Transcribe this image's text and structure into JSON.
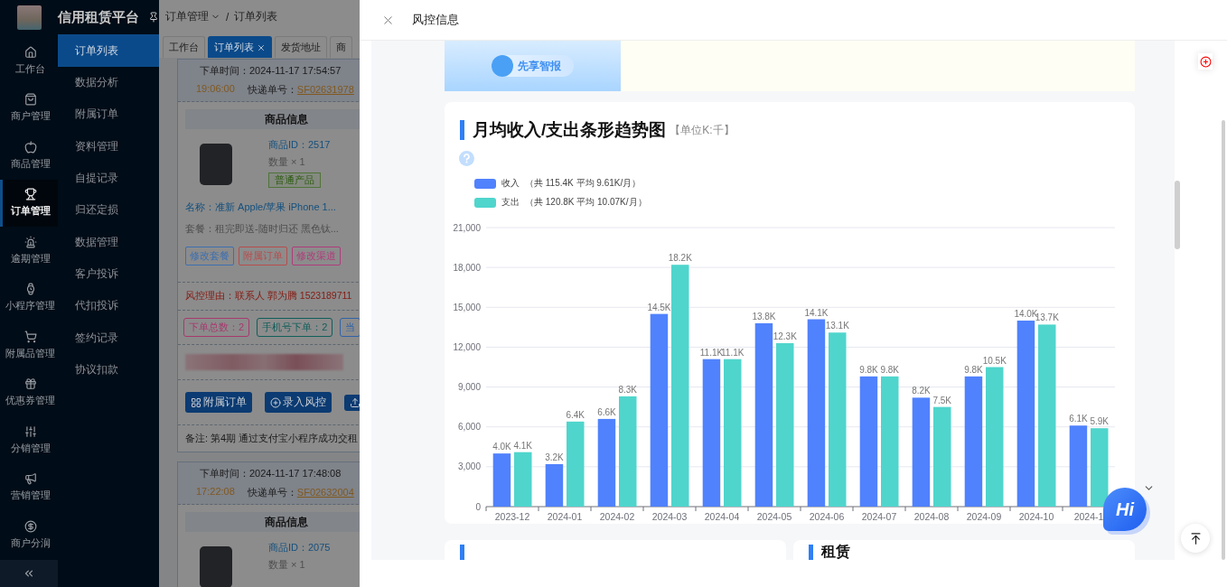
{
  "sidebar": {
    "title": "信用租赁平台",
    "rail": [
      {
        "label": "工作台",
        "selected": false
      },
      {
        "label": "商户管理",
        "selected": false
      },
      {
        "label": "商品管理",
        "selected": false
      },
      {
        "label": "订单管理",
        "selected": true
      },
      {
        "label": "逾期管理",
        "selected": false
      },
      {
        "label": "小程序管理",
        "selected": false
      },
      {
        "label": "附属品管理",
        "selected": false
      },
      {
        "label": "优惠券管理",
        "selected": false
      },
      {
        "label": "分销管理",
        "selected": false
      },
      {
        "label": "营销管理",
        "selected": false
      },
      {
        "label": "商户分润",
        "selected": false
      }
    ],
    "submenu": [
      {
        "label": "订单列表",
        "selected": true
      },
      {
        "label": "数据分析",
        "selected": false
      },
      {
        "label": "附属订单",
        "selected": false
      },
      {
        "label": "资料管理",
        "selected": false
      },
      {
        "label": "自提记录",
        "selected": false
      },
      {
        "label": "归还定损",
        "selected": false
      },
      {
        "label": "数据管理",
        "selected": false
      },
      {
        "label": "客户投诉",
        "selected": false
      },
      {
        "label": "代扣投诉",
        "selected": false
      },
      {
        "label": "签约记录",
        "selected": false
      },
      {
        "label": "协议扣款",
        "selected": false
      }
    ]
  },
  "breadcrumb": {
    "items": [
      "订单管理",
      "订单列表"
    ],
    "separator": "/"
  },
  "tabs": [
    {
      "label": "工作台",
      "selected": false,
      "closable": false
    },
    {
      "label": "订单列表",
      "selected": true,
      "closable": true
    },
    {
      "label": "发货地址",
      "selected": false,
      "closable": false
    },
    {
      "label": "商",
      "selected": false,
      "closable": false
    }
  ],
  "orders": [
    {
      "order_time": "下单时间：2024-11-17 17:54:57",
      "due_time": "19:06:00",
      "tracking_label": "快递单号：",
      "tracking_no": "SF02631978",
      "section_title": "商品信息",
      "product_id": "商品ID：2517",
      "quantity": "数量 × 1",
      "product_tag": "普通产品",
      "name": "名称：准新 Apple/苹果 iPhone 1...",
      "package": "套餐：租完即送-随时归还 黑色钛...",
      "actions": [
        {
          "label": "修改套餐",
          "color": "#3d6fb0"
        },
        {
          "label": "附属订单",
          "color": "#b84c4c"
        },
        {
          "label": "修改渠道",
          "color": "#b03c7a"
        }
      ],
      "risk_reason": "风控理由：联系人 郭为腾 1523189711",
      "stats": [
        {
          "label": "下单总数：2",
          "color": "#a8386e"
        },
        {
          "label": "手机号下单：2",
          "color": "#0f5e5a"
        },
        {
          "label": "当",
          "color": "#2f62a8"
        }
      ],
      "buttons": [
        {
          "kind": "grid",
          "label": "附属订单"
        },
        {
          "kind": "add",
          "label": "录入风控"
        },
        {
          "kind": "upload"
        }
      ],
      "note": "备注: 第4期 通过支付宝小程序成功交租"
    },
    {
      "order_time": "下单时间：2024-11-17 17:48:08",
      "due_time": "17:22:08",
      "tracking_label": "快递单号：",
      "tracking_no": "SF02632004",
      "section_title": "商品信息",
      "product_id": "商品ID：2075",
      "quantity": "数量 × 1"
    }
  ],
  "drawer": {
    "title": "风控信息",
    "banner": {
      "brand": "先享智报"
    },
    "chart_card": {
      "title": "月均收入/支出条形趋势图",
      "unit": "【单位K:千】",
      "legend": [
        {
          "summary": "（共 115.4K  平均 9.61K/月）"
        },
        {
          "summary": "（共 120.8K  平均 10.07K/月）"
        }
      ],
      "chart_data": {
        "type": "bar",
        "categories": [
          "2023-12",
          "2024-01",
          "2024-02",
          "2024-03",
          "2024-04",
          "2024-05",
          "2024-06",
          "2024-07",
          "2024-08",
          "2024-09",
          "2024-10",
          "2024-1"
        ],
        "series": [
          {
            "name": "收入",
            "color": "#5082fd",
            "values": [
              4000,
              3200,
              6600,
              14500,
              11100,
              13800,
              14100,
              9800,
              8200,
              9800,
              14000,
              6100
            ]
          },
          {
            "name": "支出",
            "color": "#4fd5cc",
            "values": [
              4100,
              6400,
              8300,
              18200,
              11100,
              12300,
              13100,
              9800,
              7500,
              10500,
              13700,
              5900
            ]
          }
        ],
        "ylim": [
          0,
          21000
        ],
        "grid": true,
        "yticks": [
          {
            "value": 0,
            "label": "0"
          },
          {
            "value": 3000,
            "label": "3,000"
          },
          {
            "value": 6000,
            "label": "6,000"
          },
          {
            "value": 9000,
            "label": "9,000"
          },
          {
            "value": 12000,
            "label": "12,000"
          },
          {
            "value": 15000,
            "label": "15,000"
          },
          {
            "value": 18000,
            "label": "18,000"
          },
          {
            "value": 21000,
            "label": "21,000"
          }
        ],
        "value_labels": [
          [
            "4.0K",
            "3.2K",
            "6.6K",
            "14.5K",
            "11.1K",
            "13.8K",
            "14.1K",
            "9.8K",
            "8.2K",
            "9.8K",
            "14.0K",
            "6.1K"
          ],
          [
            "4.1K",
            "6.4K",
            "8.3K",
            "18.2K",
            "11.1K",
            "12.3K",
            "13.1K",
            "9.8K",
            "7.5K",
            "10.5K",
            "13.7K",
            "5.9K"
          ]
        ]
      }
    },
    "bottom_cards": [
      {
        "kind": "untitled"
      },
      {
        "kind": "titled",
        "title": "租赁"
      }
    ],
    "chat_button": {
      "label": "Hi"
    }
  }
}
